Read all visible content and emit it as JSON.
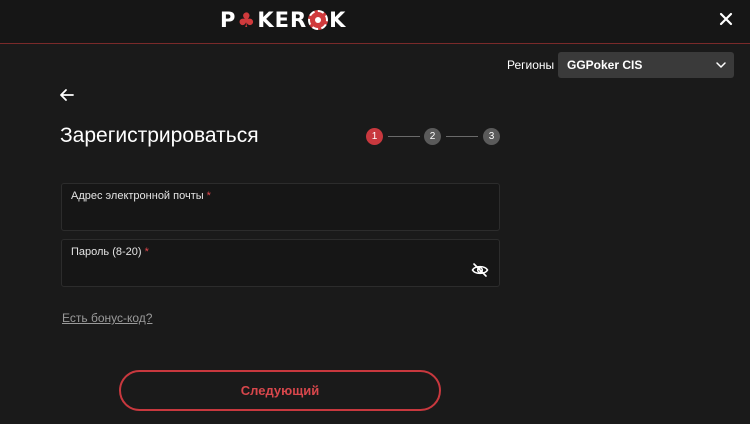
{
  "header": {
    "logo": {
      "part1": "P",
      "part2": "KER",
      "part3": "K"
    }
  },
  "region": {
    "label": "Регионы",
    "selected": "GGPoker CIS"
  },
  "form": {
    "title": "Зарегистрироваться",
    "steps": [
      "1",
      "2",
      "3"
    ],
    "active_step": 1,
    "email": {
      "label": "Адрес электронной почты",
      "required_mark": "*",
      "value": ""
    },
    "password": {
      "label": "Пароль (8-20)",
      "required_mark": "*",
      "value": ""
    },
    "bonus_link": "Есть бонус-код?",
    "next_label": "Следующий"
  },
  "colors": {
    "accent": "#c8383e",
    "background": "#1a1a1a",
    "field_bg": "#161616"
  },
  "icons": {
    "close": "close-icon",
    "back": "arrow-left-icon",
    "dropdown": "chevron-down-icon",
    "visibility": "eye-off-icon"
  }
}
